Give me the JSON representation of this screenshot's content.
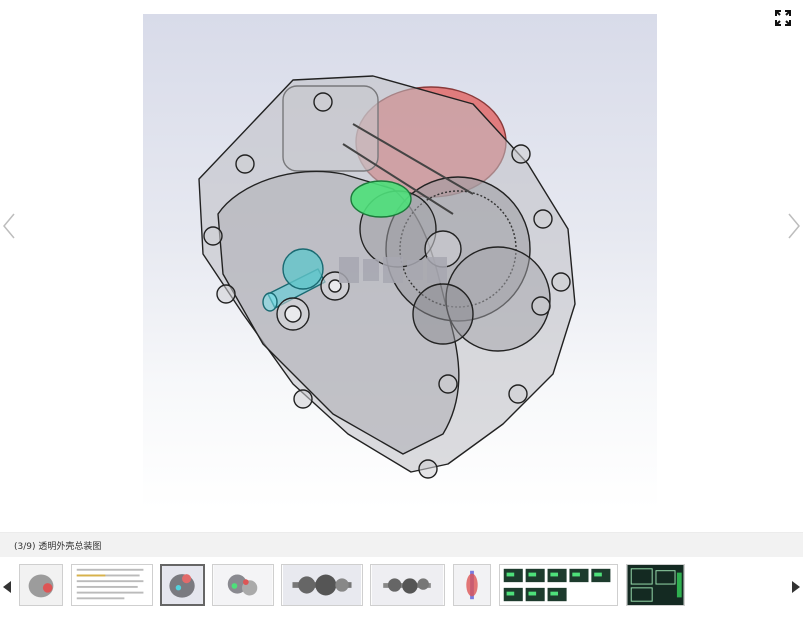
{
  "viewer": {
    "caption": "(3/9) 透明外壳总装图",
    "current_index": 3,
    "total": 9
  },
  "icons": {
    "fullscreen": "fullscreen-expand-icon",
    "prev": "chevron-left-icon",
    "next": "chevron-right-icon",
    "strip_prev": "triangle-left-icon",
    "strip_next": "triangle-right-icon"
  },
  "colors": {
    "stage_top": "#d8dbe9",
    "caption_bar": "#f2f2f2",
    "red_part": "#e26a6a",
    "green_gear": "#4ee07a",
    "cyan_shaft": "#52d2dd"
  }
}
